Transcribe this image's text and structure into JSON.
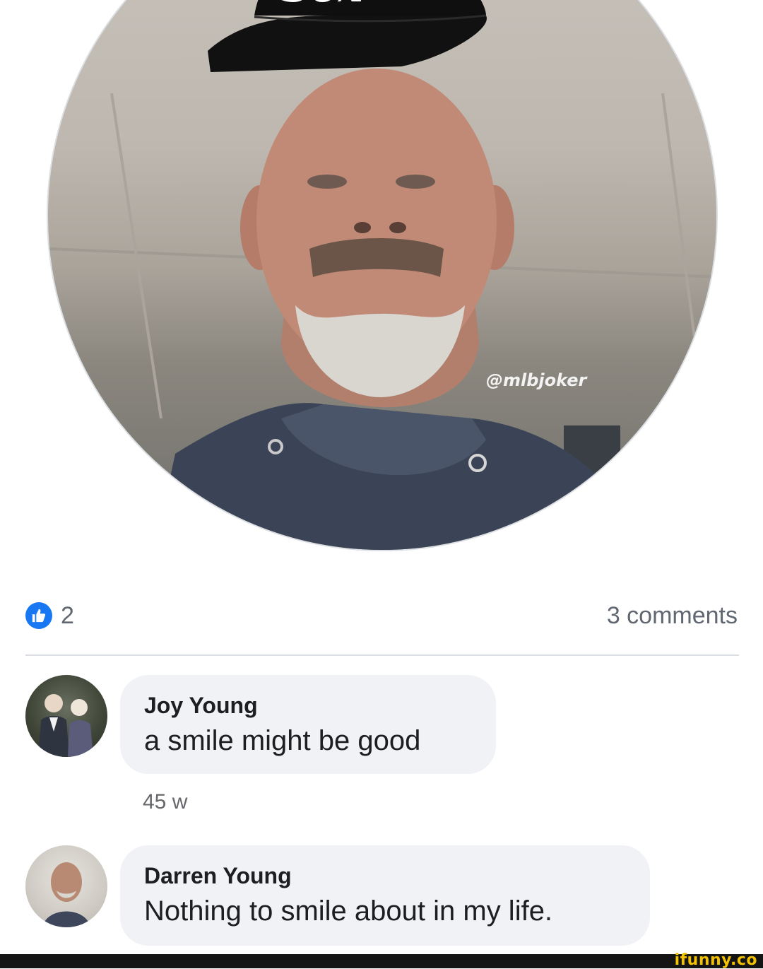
{
  "photo": {
    "watermark": "@mlbjoker",
    "cap_logo": "Sox",
    "icons": {
      "cap": "baseball-cap-icon",
      "mlb_logo": "mlb-logo-icon"
    }
  },
  "reactions": {
    "like_count": "2",
    "comments_count": "3 comments",
    "like_color": "#1877f2",
    "icon": "thumbs-up-icon"
  },
  "comments": [
    {
      "author": "Joy Young",
      "text": "a smile might be good",
      "time": "45 w"
    },
    {
      "author": "Darren Young",
      "text": "Nothing to smile about in my life."
    }
  ],
  "footer": {
    "logo": "ifunny.co",
    "logo_color": "#f2c200"
  }
}
